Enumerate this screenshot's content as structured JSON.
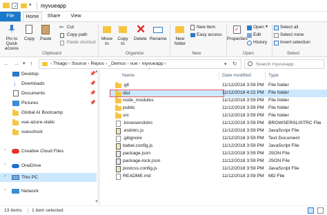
{
  "window": {
    "title": "myvueapp"
  },
  "ribbon_tabs": [
    "File",
    "Home",
    "Share",
    "View"
  ],
  "ribbon": {
    "pin_label": "Pin to Quick access",
    "copy_label": "Copy",
    "paste_label": "Paste",
    "cut_label": "Cut",
    "copy_path_label": "Copy path",
    "paste_shortcut_label": "Paste shortcut",
    "clipboard_group": "Clipboard",
    "move_to_label": "Move to",
    "copy_to_label": "Copy to",
    "delete_label": "Delete",
    "rename_label": "Rename",
    "organize_group": "Organize",
    "new_folder_label": "New folder",
    "new_item_label": "New item",
    "easy_access_label": "Easy access",
    "new_group": "New",
    "properties_label": "Properties",
    "open_label": "Open",
    "edit_label": "Edit",
    "history_label": "History",
    "open_group": "Open",
    "select_all_label": "Select all",
    "select_none_label": "Select none",
    "invert_selection_label": "Invert selection",
    "select_group": "Select"
  },
  "address": {
    "crumbs": [
      "Thiago",
      "Source",
      "Repos",
      "_Demos",
      "vue",
      "myvueapp"
    ],
    "search_placeholder": "Search myvueapp"
  },
  "columns": [
    "Name",
    "Date modified",
    "Type"
  ],
  "files": [
    {
      "name": ".git",
      "date": "11/12/2018 3:59 PM",
      "type": "File folder",
      "kind": "folder"
    },
    {
      "name": "dist",
      "date": "11/12/2018 4:22 PM",
      "type": "File folder",
      "kind": "folder"
    },
    {
      "name": "node_modules",
      "date": "11/12/2018 3:59 PM",
      "type": "File folder",
      "kind": "folder"
    },
    {
      "name": "public",
      "date": "11/12/2018 3:59 PM",
      "type": "File folder",
      "kind": "folder"
    },
    {
      "name": "src",
      "date": "11/12/2018 3:59 PM",
      "type": "File folder",
      "kind": "folder"
    },
    {
      "name": ".browserslistrc",
      "date": "11/12/2018 3:59 PM",
      "type": "BROWSERSLISTRC File",
      "kind": "file"
    },
    {
      "name": ".eslintrc.js",
      "date": "11/12/2018 3:59 PM",
      "type": "JavaScript File",
      "kind": "js"
    },
    {
      "name": ".gitignore",
      "date": "11/12/2018 3:59 PM",
      "type": "Text Document",
      "kind": "file"
    },
    {
      "name": "babel.config.js",
      "date": "11/12/2018 3:59 PM",
      "type": "JavaScript File",
      "kind": "js"
    },
    {
      "name": "package.json",
      "date": "11/12/2018 3:59 PM",
      "type": "JSON File",
      "kind": "js"
    },
    {
      "name": "package-lock.json",
      "date": "11/12/2018 3:59 PM",
      "type": "JSON File",
      "kind": "js"
    },
    {
      "name": "postcss.config.js",
      "date": "11/12/2018 3:59 PM",
      "type": "JavaScript File",
      "kind": "js"
    },
    {
      "name": "README.md",
      "date": "11/12/2018 3:59 PM",
      "type": "MD File",
      "kind": "file"
    }
  ],
  "nav": [
    {
      "label": "Desktop",
      "icon": "desktop-icon"
    },
    {
      "label": "Downloads",
      "icon": "downloads-icon"
    },
    {
      "label": "Documents",
      "icon": "documents-icon"
    },
    {
      "label": "Pictures",
      "icon": "pictures-icon"
    },
    {
      "label": "Global AI Bootcamp",
      "icon": "folder-icon"
    },
    {
      "label": "vue-azure-static",
      "icon": "folder-icon"
    },
    {
      "label": "vueschool",
      "icon": "folder-icon"
    },
    {
      "label": "Creative Cloud Files",
      "icon": "creative-cloud-icon"
    },
    {
      "label": "OneDrive",
      "icon": "onedrive-icon"
    },
    {
      "label": "This PC",
      "icon": "this-pc-icon"
    },
    {
      "label": "Network",
      "icon": "network-icon"
    }
  ],
  "status": {
    "count": "13 items",
    "selected": "1 item selected"
  },
  "colors": {
    "accent": "#1979ca",
    "selection_border": "#e05a5a",
    "selection_bg": "#cce8ff",
    "folder": "#f5c542"
  }
}
